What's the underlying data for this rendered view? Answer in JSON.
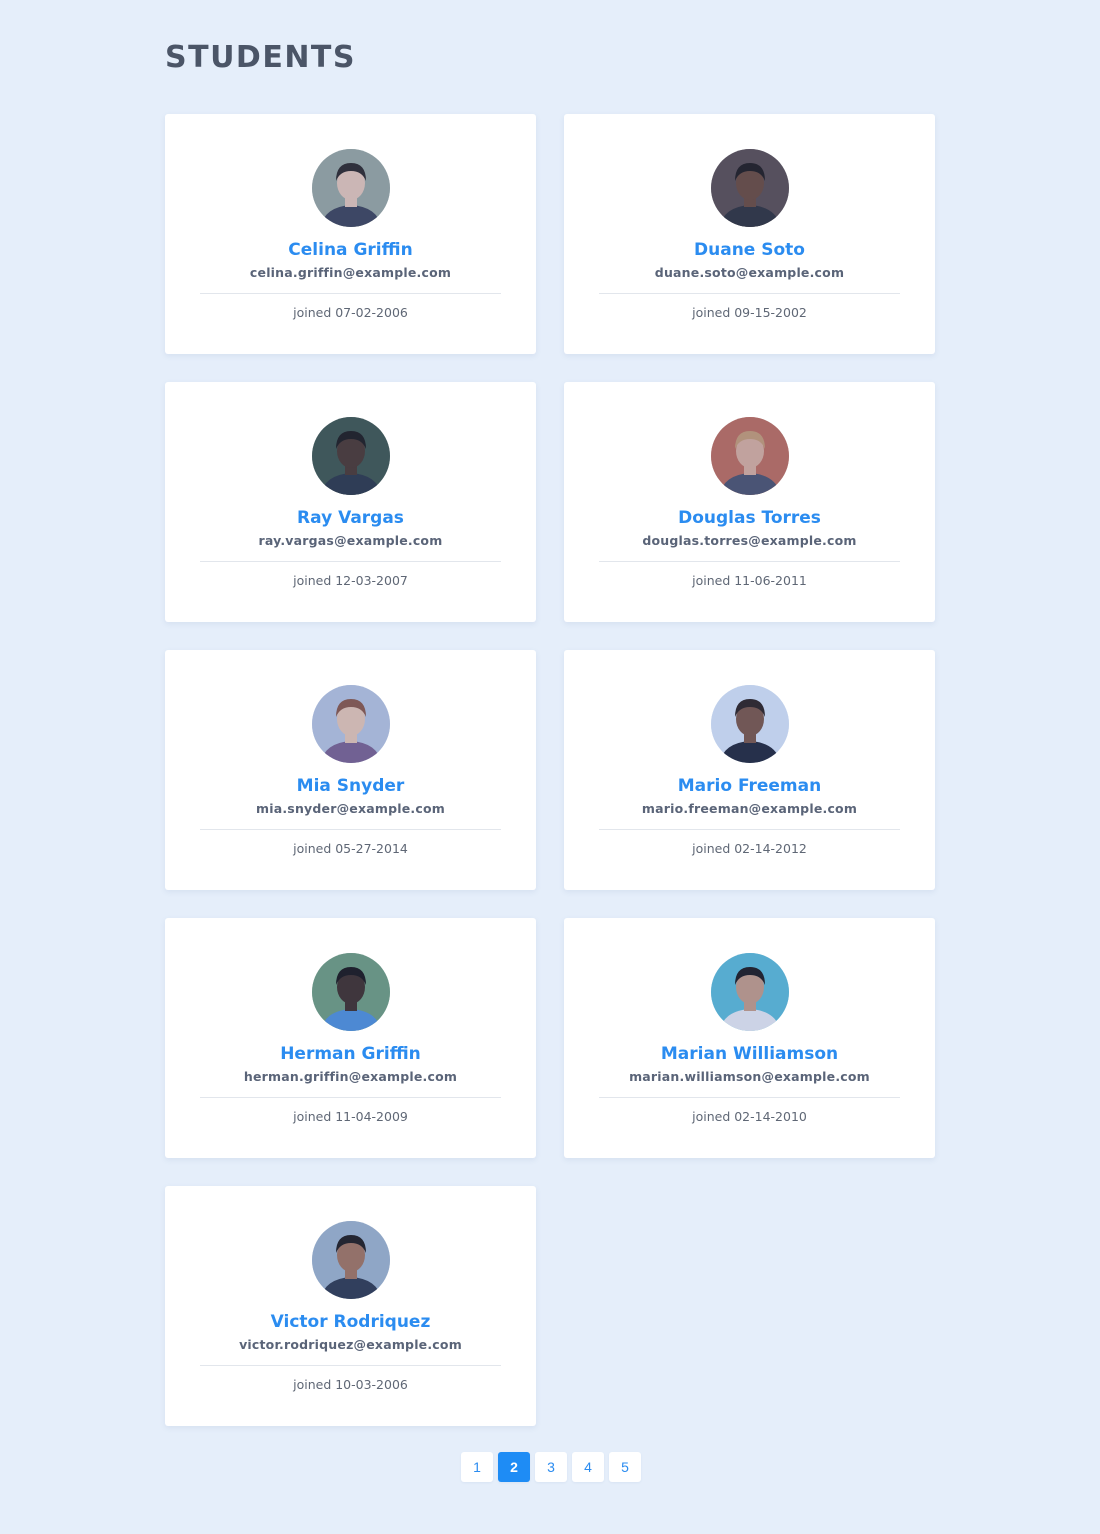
{
  "page": {
    "title": "STUDENTS"
  },
  "colors": {
    "background": "#e5eefa",
    "accent": "#2b8cf0",
    "title": "#4b5567",
    "card": "#ffffff"
  },
  "students": [
    {
      "name": "Celina Griffin",
      "email": "celina.griffin@example.com",
      "joined": "joined 07-02-2006",
      "avatar": {
        "skin": "#e8c6b4",
        "hair": "#2a2320",
        "bg": "#9aa59b",
        "shirt": "#3b3f52"
      }
    },
    {
      "name": "Duane Soto",
      "email": "duane.soto@example.com",
      "joined": "joined 09-15-2002",
      "avatar": {
        "skin": "#6b4634",
        "hair": "#1d1513",
        "bg": "#5a4a4a",
        "shirt": "#2d2d33"
      }
    },
    {
      "name": "Ray Vargas",
      "email": "ray.vargas@example.com",
      "joined": "joined 12-03-2007",
      "avatar": {
        "skin": "#4a3226",
        "hair": "#1a1512",
        "bg": "#3e5246",
        "shirt": "#2a3340"
      }
    },
    {
      "name": "Douglas Torres",
      "email": "douglas.torres@example.com",
      "joined": "joined 11-06-2011",
      "avatar": {
        "skin": "#dcae98",
        "hair": "#c89a6e",
        "bg": "#c06a55",
        "shirt": "#4b4f66"
      }
    },
    {
      "name": "Mia Snyder",
      "email": "mia.snyder@example.com",
      "joined": "joined 05-27-2014",
      "avatar": {
        "skin": "#e9c6b0",
        "hair": "#8a5440",
        "bg": "#b9c4dc",
        "shirt": "#7a5e8a"
      }
    },
    {
      "name": "Mario Freeman",
      "email": "mario.freeman@example.com",
      "joined": "joined 02-14-2012",
      "avatar": {
        "skin": "#7a5240",
        "hair": "#2a1d18",
        "bg": "#d9e5f6",
        "shirt": "#1f2333"
      }
    },
    {
      "name": "Herman Griffin",
      "email": "herman.griffin@example.com",
      "joined": "joined 11-04-2009",
      "avatar": {
        "skin": "#3e2a22",
        "hair": "#17110f",
        "bg": "#6f9c79",
        "shirt": "#4f8fd8"
      }
    },
    {
      "name": "Marian Williamson",
      "email": "marian.williamson@example.com",
      "joined": "joined 02-14-2010",
      "avatar": {
        "skin": "#c69a82",
        "hair": "#1a1414",
        "bg": "#5bbad5",
        "shirt": "#e9e9ef"
      }
    },
    {
      "name": "Victor Rodriquez",
      "email": "victor.rodriquez@example.com",
      "joined": "joined 10-03-2006",
      "avatar": {
        "skin": "#a47258",
        "hair": "#1d1614",
        "bg": "#9fb2c8",
        "shirt": "#2d3548"
      }
    }
  ],
  "pagination": {
    "pages": [
      "1",
      "2",
      "3",
      "4",
      "5"
    ],
    "current": "2"
  }
}
